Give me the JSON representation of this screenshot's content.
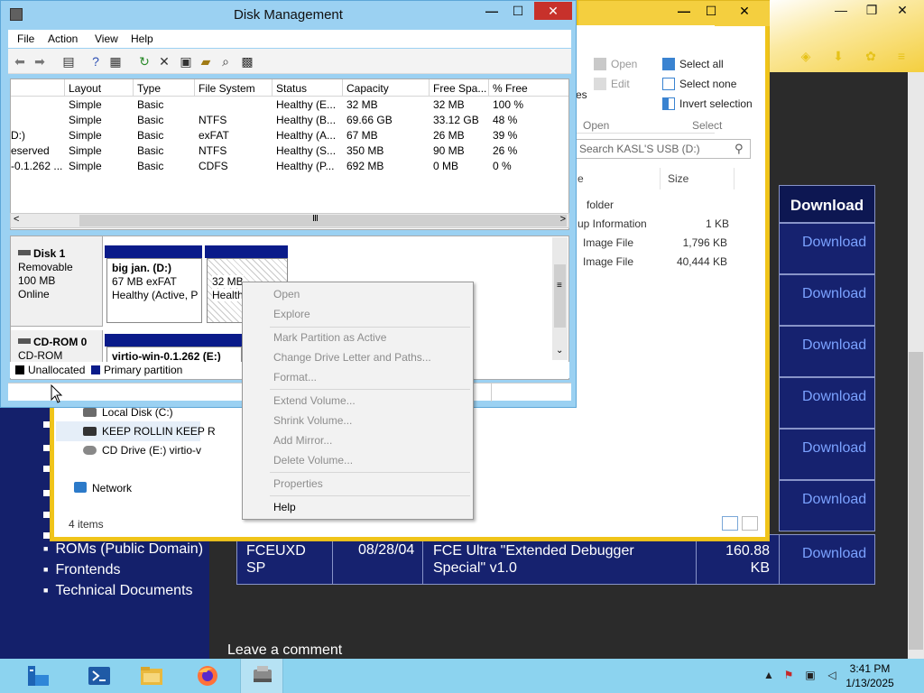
{
  "browser": {
    "download_header": "Download",
    "download_links": [
      "Download",
      "Download",
      "Download",
      "Download",
      "Download",
      "Download",
      "Download"
    ],
    "fceu_row": {
      "name": "FCEUXD SP",
      "date": "08/28/04",
      "desc": "FCE Ultra \"Extended Debugger Special\" v1.0",
      "size": "160.88 KB"
    },
    "nav_items": [
      "ROMs (Public Domain)",
      "Frontends",
      "Technical Documents"
    ],
    "leave_comment": "Leave a comment",
    "window_controls": {
      "minimize": "—",
      "maximize": "❐",
      "close": "✕"
    }
  },
  "explorer": {
    "window_controls": {
      "minimize": "—",
      "maximize": "☐",
      "close": "✕"
    },
    "ribbon": {
      "open": "Open",
      "edit": "Edit",
      "select_all": "Select all",
      "select_none": "Select none",
      "invert_selection": "Invert selection",
      "group_open": "Open",
      "group_select": "Select",
      "fragment": "es"
    },
    "search_placeholder": "Search KASL'S USB (D:)",
    "columns": {
      "name_fragment": "e",
      "size": "Size"
    },
    "files": [
      {
        "name": "folder",
        "size": ""
      },
      {
        "name": "up Information",
        "size": "1 KB"
      },
      {
        "name": "Image File",
        "size": "1,796 KB"
      },
      {
        "name": "Image File",
        "size": "40,444 KB"
      }
    ],
    "nav": [
      {
        "label": "Local Disk (C:)"
      },
      {
        "label": "KEEP ROLLIN KEEP R"
      },
      {
        "label": "CD Drive (E:) virtio-v"
      },
      {
        "label": "Network"
      }
    ],
    "status": "4 items"
  },
  "diskmgmt": {
    "title": "Disk Management",
    "window_controls": {
      "minimize": "—",
      "maximize": "☐",
      "close": "✕"
    },
    "menu": [
      "File",
      "Action",
      "View",
      "Help"
    ],
    "list_headers": [
      "Layout",
      "Type",
      "File System",
      "Status",
      "Capacity",
      "Free Spa...",
      "% Free"
    ],
    "volumes": [
      {
        "volume": "",
        "layout": "Simple",
        "type": "Basic",
        "fs": "",
        "status": "Healthy (E...",
        "capacity": "32 MB",
        "free": "32 MB",
        "pct": "100 %"
      },
      {
        "volume": "",
        "layout": "Simple",
        "type": "Basic",
        "fs": "NTFS",
        "status": "Healthy (B...",
        "capacity": "69.66 GB",
        "free": "33.12 GB",
        "pct": "48 %"
      },
      {
        "volume": "D:)",
        "layout": "Simple",
        "type": "Basic",
        "fs": "exFAT",
        "status": "Healthy (A...",
        "capacity": "67 MB",
        "free": "26 MB",
        "pct": "39 %"
      },
      {
        "volume": "eserved",
        "layout": "Simple",
        "type": "Basic",
        "fs": "NTFS",
        "status": "Healthy (S...",
        "capacity": "350 MB",
        "free": "90 MB",
        "pct": "26 %"
      },
      {
        "volume": "-0.1.262 ...",
        "layout": "Simple",
        "type": "Basic",
        "fs": "CDFS",
        "status": "Healthy (P...",
        "capacity": "692 MB",
        "free": "0 MB",
        "pct": "0 %"
      }
    ],
    "disk1": {
      "name": "Disk 1",
      "kind": "Removable",
      "size": "100 MB",
      "state": "Online",
      "part1": {
        "label": "big jan.  (D:)",
        "detail": "67 MB exFAT",
        "status": "Healthy (Active, P"
      },
      "part2": {
        "size": "32 MB",
        "status": "Health"
      }
    },
    "cdrom": {
      "name": "CD-ROM 0",
      "kind": "CD-ROM",
      "part": "virtio-win-0.1.262  (E:)"
    },
    "legend": {
      "unallocated": "Unallocated",
      "primary": "Primary partition"
    }
  },
  "context_menu": [
    {
      "label": "Open",
      "enabled": false
    },
    {
      "label": "Explore",
      "enabled": false
    },
    {
      "label": "Mark Partition as Active",
      "enabled": false
    },
    {
      "label": "Change Drive Letter and Paths...",
      "enabled": false
    },
    {
      "label": "Format...",
      "enabled": false
    },
    {
      "label": "Extend Volume...",
      "enabled": false
    },
    {
      "label": "Shrink Volume...",
      "enabled": false
    },
    {
      "label": "Add Mirror...",
      "enabled": false
    },
    {
      "label": "Delete Volume...",
      "enabled": false
    },
    {
      "label": "Properties",
      "enabled": false
    },
    {
      "label": "Help",
      "enabled": true
    }
  ],
  "taskbar": {
    "time": "3:41 PM",
    "date": "1/13/2025",
    "tray_arrow": "▲",
    "tray_icons": [
      "flag-icon",
      "network-icon",
      "volume-icon"
    ],
    "tasks": [
      "server-manager",
      "powershell",
      "file-explorer",
      "firefox",
      "disk-management"
    ]
  },
  "colors": {
    "partition_bar": "#0a1b8a",
    "nav_blue": "#14206b",
    "taskbar": "#8cd3ef",
    "close_red": "#c7312b",
    "link_blue": "#7ba2ff"
  }
}
